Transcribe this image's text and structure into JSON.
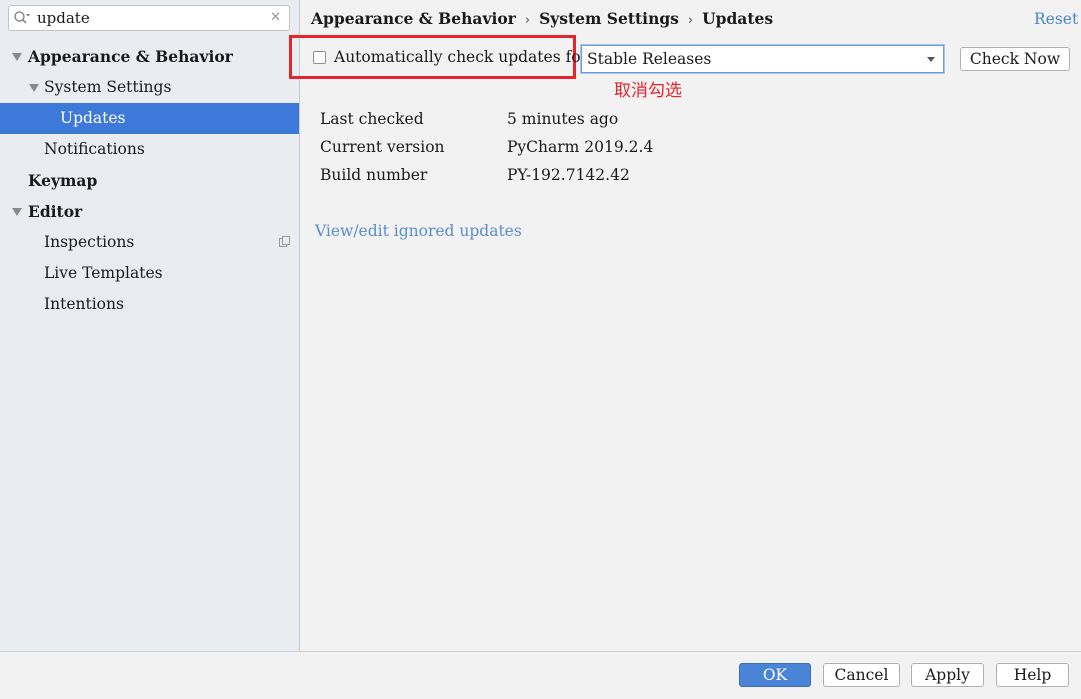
{
  "search": {
    "value": "update"
  },
  "sidebar": {
    "items": [
      {
        "label": "Appearance & Behavior"
      },
      {
        "label": "System Settings"
      },
      {
        "label": "Updates"
      },
      {
        "label": "Notifications"
      },
      {
        "label": "Keymap"
      },
      {
        "label": "Editor"
      },
      {
        "label": "Inspections"
      },
      {
        "label": "Live Templates"
      },
      {
        "label": "Intentions"
      }
    ]
  },
  "breadcrumb": [
    "Appearance & Behavior",
    "System Settings",
    "Updates"
  ],
  "reset_label": "Reset",
  "auto_check": {
    "label": "Automatically check updates for",
    "checked": false,
    "channel": "Stable Releases"
  },
  "check_now_label": "Check Now",
  "annotation": "取消勾选",
  "info": [
    {
      "key": "Last checked",
      "value": "5 minutes ago"
    },
    {
      "key": "Current version",
      "value": "PyCharm 2019.2.4"
    },
    {
      "key": "Build number",
      "value": "PY-192.7142.42"
    }
  ],
  "ignored_link": "View/edit ignored updates",
  "footer": {
    "ok": "OK",
    "cancel": "Cancel",
    "apply": "Apply",
    "help": "Help"
  },
  "colors": {
    "selection": "#3d79d8",
    "highlight_box": "#e5252d",
    "link": "#5a8dc9"
  }
}
